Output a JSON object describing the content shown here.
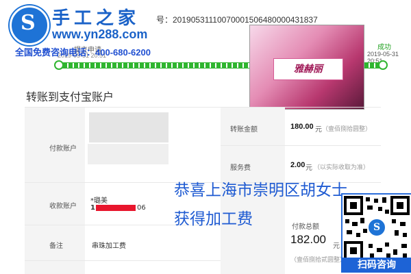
{
  "brand": {
    "logo_letter": "S",
    "title": "手工之家",
    "url": "www.yn288.com",
    "hotline": "全国免费咨询电话：400-680-6200"
  },
  "transaction": {
    "order_number": "号：20190531110070001506480000431837",
    "step_submitted": {
      "label": "提交申请",
      "time": "2019-05-31 20:51"
    },
    "step_success": {
      "label": "成功",
      "time": "2019-05-31 20:51"
    },
    "progress": 1.0
  },
  "ad": {
    "badge_text": "雅赫丽"
  },
  "section_title": "转账到支付宝账户",
  "table": {
    "payer_label": "付款账户",
    "payee_label": "收款账户",
    "payee_name": "*璐美",
    "payee_account_tail": "06",
    "payee_account_prefix": "1",
    "remark_label": "备注",
    "remark_value": "串珠加工费",
    "transfer_amount_label": "转账金额",
    "transfer_amount_value": "180.00",
    "transfer_amount_unit": "元",
    "transfer_amount_words": "（壹佰捌拾圆整）",
    "service_fee_label": "服务费",
    "service_fee_value": "2.00",
    "service_fee_unit": "元",
    "service_fee_note": "（以实际收取为准）",
    "total_label": "付款总额",
    "total_value": "182.00",
    "total_unit": "元",
    "total_words": "（壹佰捌拾贰圆整）"
  },
  "slogan": {
    "line1": "恭喜上海市崇明区胡女士",
    "line2": "获得加工费"
  },
  "qr": {
    "center_letter": "S",
    "caption": "扫码咨询"
  },
  "colors": {
    "brand_blue": "#1a62c8",
    "progress_green": "#2fb52f",
    "slogan_blue": "#1f5bd2",
    "redact_red": "#e8162d"
  }
}
